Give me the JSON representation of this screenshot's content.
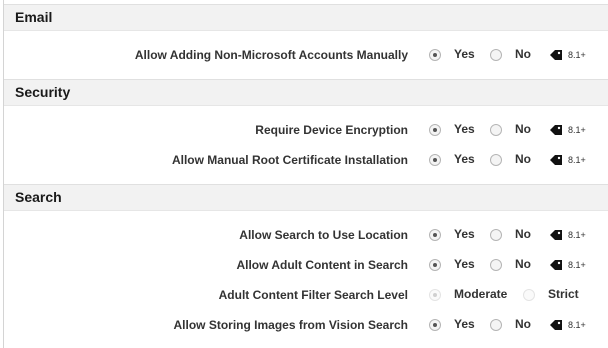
{
  "sections": [
    {
      "title": "Email",
      "settings": [
        {
          "label": "Allow Adding Non-Microsoft Accounts Manually",
          "options": [
            "Yes",
            "No"
          ],
          "selected": "Yes",
          "version": "8.1+"
        }
      ]
    },
    {
      "title": "Security",
      "settings": [
        {
          "label": "Require Device Encryption",
          "options": [
            "Yes",
            "No"
          ],
          "selected": "Yes",
          "version": "8.1+"
        },
        {
          "label": "Allow Manual Root Certificate Installation",
          "options": [
            "Yes",
            "No"
          ],
          "selected": "Yes",
          "version": "8.1+"
        }
      ]
    },
    {
      "title": "Search",
      "settings": [
        {
          "label": "Allow Search to Use Location",
          "options": [
            "Yes",
            "No"
          ],
          "selected": "Yes",
          "version": "8.1+"
        },
        {
          "label": "Allow Adult Content in Search",
          "options": [
            "Yes",
            "No"
          ],
          "selected": "Yes",
          "version": "8.1+"
        },
        {
          "label": "Adult Content Filter Search Level",
          "options": [
            "Moderate",
            "Strict"
          ],
          "selected": "Moderate",
          "disabled": true
        },
        {
          "label": "Allow Storing Images from Vision Search",
          "options": [
            "Yes",
            "No"
          ],
          "selected": "Yes",
          "version": "8.1+"
        }
      ]
    }
  ],
  "icons": {
    "version_tag": "tag-icon"
  }
}
